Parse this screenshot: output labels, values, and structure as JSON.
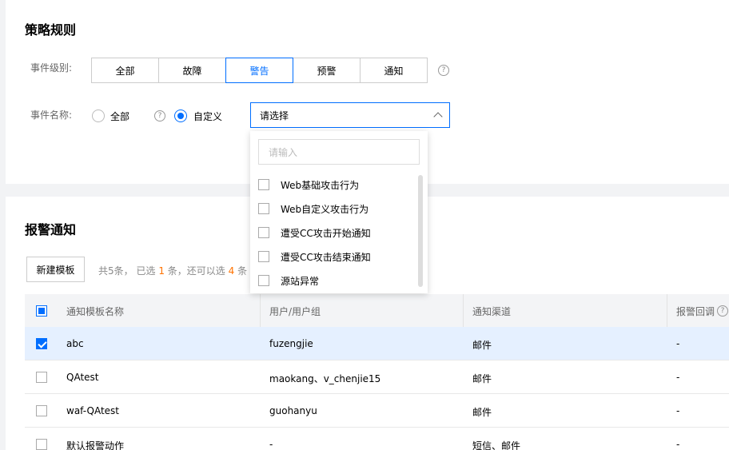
{
  "policy": {
    "title": "策略规则",
    "level_label": "事件级别:",
    "levels": [
      "全部",
      "故障",
      "警告",
      "预警",
      "通知"
    ],
    "active_level": "警告",
    "name_label": "事件名称:",
    "radio_all": "全部",
    "radio_custom": "自定义",
    "select_placeholder": "请选择",
    "help_glyph": "?",
    "dropdown": {
      "search_placeholder": "请输入",
      "items": [
        "Web基础攻击行为",
        "Web自定义攻击行为",
        "遭受CC攻击开始通知",
        "遭受CC攻击结束通知",
        "源站异常"
      ]
    }
  },
  "alarm": {
    "title": "报警通知",
    "new_button": "新建模板",
    "summary_total": "共5条，",
    "summary_selected_prefix": "已选",
    "summary_selected_count": "1",
    "summary_selected_suffix": "条，还可以选",
    "summary_remaining": "4",
    "summary_unit": "条",
    "columns": [
      "通知模板名称",
      "用户/用户组",
      "通知渠道",
      "报警回调"
    ],
    "rows": [
      {
        "name": "abc",
        "users": "fuzengjie",
        "channel": "邮件",
        "callback": "-",
        "checked": true
      },
      {
        "name": "QAtest",
        "users": "maokang、v_chenjie15",
        "channel": "邮件",
        "callback": "-",
        "checked": false
      },
      {
        "name": "waf-QAtest",
        "users": "guohanyu",
        "channel": "邮件",
        "callback": "-",
        "checked": false
      },
      {
        "name": "默认报警动作",
        "users": "-",
        "channel": "短信、邮件",
        "callback": "-",
        "checked": false
      }
    ]
  },
  "colors": {
    "accent": "#006eff",
    "highlight": "#ff7200",
    "selected_row": "#e5f0ff"
  }
}
